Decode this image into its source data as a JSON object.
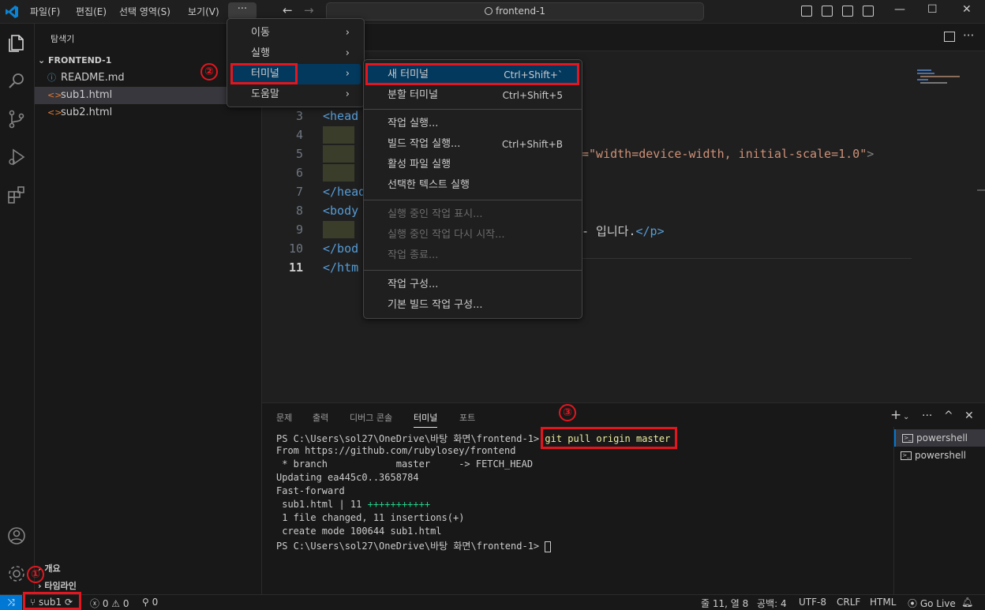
{
  "titlebar": {
    "menus": [
      "파일(F)",
      "편집(E)",
      "선택 영역(S)",
      "보기(V)"
    ],
    "more": "···",
    "search": "frontend-1"
  },
  "sidebar": {
    "title": "탐색기",
    "folder": "FRONTEND-1",
    "files": [
      {
        "icon": "ⓘ",
        "name": "README.md"
      },
      {
        "icon": "<>",
        "name": "sub1.html"
      },
      {
        "icon": "<>",
        "name": "sub2.html"
      }
    ],
    "sections": [
      "개요",
      "타임라인"
    ]
  },
  "editor": {
    "line_numbers": [
      "3",
      "4",
      "5",
      "6",
      "7",
      "8",
      "9",
      "10",
      "11"
    ],
    "code": {
      "l3": "<head",
      "l5_attr": "=\"width=device-width, initial-scale=1.0\"",
      "l5_end": ">",
      "l7": "</head",
      "l8": "<body",
      "l9_text": "- 입니다.",
      "l9_end": "</p>",
      "l10": "</bod",
      "l11": "</htm"
    }
  },
  "main_menu": {
    "items": [
      "이동",
      "실행",
      "터미널",
      "도움말"
    ]
  },
  "terminal_menu": {
    "items": [
      {
        "label": "새 터미널",
        "shortcut": "Ctrl+Shift+`"
      },
      {
        "label": "분할 터미널",
        "shortcut": "Ctrl+Shift+5"
      },
      {
        "label": "작업 실행...",
        "shortcut": ""
      },
      {
        "label": "빌드 작업 실행...",
        "shortcut": "Ctrl+Shift+B"
      },
      {
        "label": "활성 파일 실행",
        "shortcut": ""
      },
      {
        "label": "선택한 텍스트 실행",
        "shortcut": ""
      },
      {
        "label": "실행 중인 작업 표시...",
        "shortcut": ""
      },
      {
        "label": "실행 중인 작업 다시 시작...",
        "shortcut": ""
      },
      {
        "label": "작업 종료...",
        "shortcut": ""
      },
      {
        "label": "작업 구성...",
        "shortcut": ""
      },
      {
        "label": "기본 빌드 작업 구성...",
        "shortcut": ""
      }
    ]
  },
  "panel": {
    "tabs": [
      "문제",
      "출력",
      "디버그 콘솔",
      "터미널",
      "포트"
    ],
    "terminal_lines": [
      "PS C:\\Users\\sol27\\OneDrive\\바탕 화면\\frontend-1> ",
      "From https://github.com/rubylosey/frontend",
      " * branch            master     -> FETCH_HEAD",
      "Updating ea445c0..3658784",
      "Fast-forward",
      " sub1.html | 11 ",
      " 1 file changed, 11 insertions(+)",
      " create mode 100644 sub1.html",
      "PS C:\\Users\\sol27\\OneDrive\\바탕 화면\\frontend-1> "
    ],
    "command": "git pull origin master",
    "plus_signs": "+++++++++++",
    "terminals": [
      "powershell",
      "powershell"
    ]
  },
  "statusbar": {
    "branch": "sub1",
    "errors": "0",
    "warnings": "0",
    "ports": "0",
    "position": "줄 11, 열 8",
    "spaces": "공백: 4",
    "encoding": "UTF-8",
    "eol": "CRLF",
    "language": "HTML",
    "golive": "Go Live"
  },
  "annotations": {
    "num1": "①",
    "num2": "②",
    "num3": "③",
    "color": "#e3161f"
  }
}
